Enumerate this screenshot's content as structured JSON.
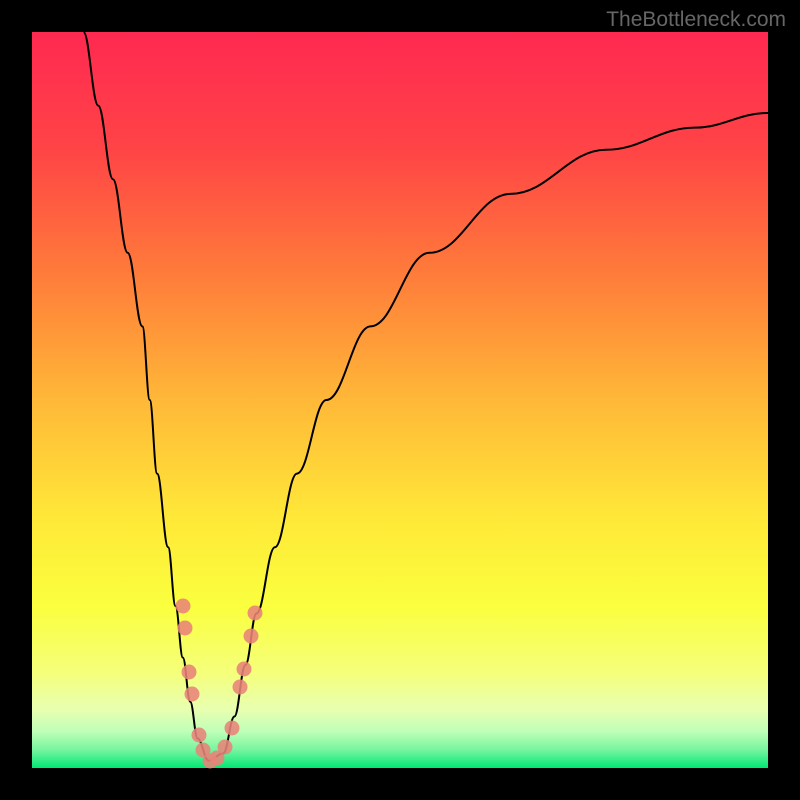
{
  "watermark": "TheBottleneck.com",
  "chart_data": {
    "type": "line",
    "title": "",
    "xlabel": "",
    "ylabel": "",
    "xlim": [
      0,
      100
    ],
    "ylim": [
      0,
      100
    ],
    "gradient_colors": {
      "top": "#ff2951",
      "upper_mid": "#ff6b3d",
      "mid": "#ffb838",
      "lower_mid": "#ffe838",
      "lower": "#f5ff4a",
      "near_bottom": "#d8ff7e",
      "bottom": "#00e874"
    },
    "curve_points": [
      {
        "x": 7,
        "y": 100
      },
      {
        "x": 9,
        "y": 90
      },
      {
        "x": 11,
        "y": 80
      },
      {
        "x": 13,
        "y": 70
      },
      {
        "x": 15,
        "y": 60
      },
      {
        "x": 16,
        "y": 50
      },
      {
        "x": 17,
        "y": 40
      },
      {
        "x": 18.5,
        "y": 30
      },
      {
        "x": 19.5,
        "y": 22
      },
      {
        "x": 20.5,
        "y": 15
      },
      {
        "x": 21.5,
        "y": 9
      },
      {
        "x": 22.5,
        "y": 4
      },
      {
        "x": 24,
        "y": 1
      },
      {
        "x": 26,
        "y": 2
      },
      {
        "x": 27.5,
        "y": 7
      },
      {
        "x": 29,
        "y": 14
      },
      {
        "x": 30.5,
        "y": 21
      },
      {
        "x": 33,
        "y": 30
      },
      {
        "x": 36,
        "y": 40
      },
      {
        "x": 40,
        "y": 50
      },
      {
        "x": 46,
        "y": 60
      },
      {
        "x": 54,
        "y": 70
      },
      {
        "x": 65,
        "y": 78
      },
      {
        "x": 78,
        "y": 84
      },
      {
        "x": 90,
        "y": 87
      },
      {
        "x": 100,
        "y": 89
      }
    ],
    "markers": [
      {
        "x": 20.5,
        "y": 22
      },
      {
        "x": 20.8,
        "y": 19
      },
      {
        "x": 21.3,
        "y": 13
      },
      {
        "x": 21.7,
        "y": 10
      },
      {
        "x": 22.7,
        "y": 4.5
      },
      {
        "x": 23.3,
        "y": 2.5
      },
      {
        "x": 24.2,
        "y": 1
      },
      {
        "x": 25.2,
        "y": 1.3
      },
      {
        "x": 26.2,
        "y": 2.8
      },
      {
        "x": 27.2,
        "y": 5.5
      },
      {
        "x": 28.3,
        "y": 11
      },
      {
        "x": 28.8,
        "y": 13.5
      },
      {
        "x": 29.8,
        "y": 18
      },
      {
        "x": 30.3,
        "y": 21
      }
    ],
    "marker_color": "#e88379"
  }
}
